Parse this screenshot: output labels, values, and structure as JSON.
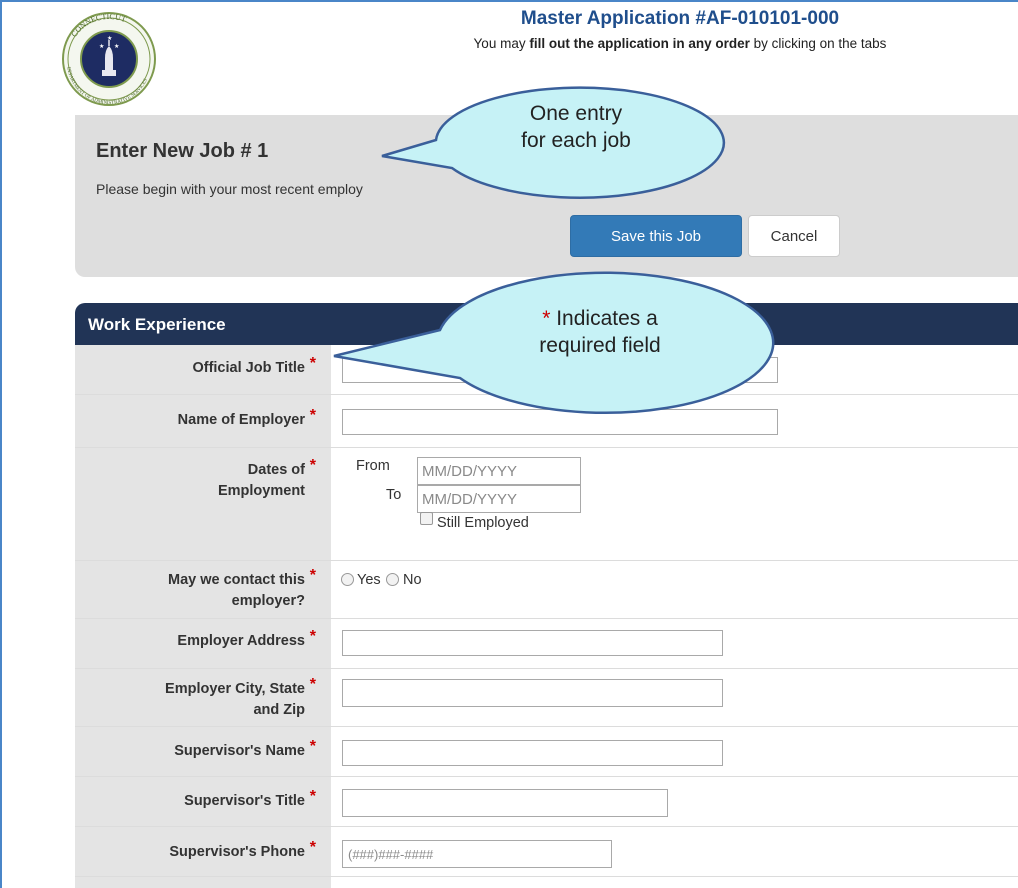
{
  "header": {
    "title": "Master Application #AF-010101-000",
    "sub_pre": "You may ",
    "sub_bold1": "fill out the application in any order",
    "sub_post": " by clicking on the tabs",
    "logo_icon": "connecticut-das-seal-icon",
    "logo_text_top": "CONNECTICUT",
    "logo_text_bottom": "DEPARTMENT OF ADMINISTRATIVE SERVICES"
  },
  "job": {
    "title": "Enter New Job # 1",
    "subtitle": "Please begin with your most recent employ",
    "save_label": "Save this Job",
    "cancel_label": "Cancel"
  },
  "callouts": {
    "one_line1": "One entry",
    "one_line2": "for each job",
    "req_star": "*",
    "req_line1": " Indicates a",
    "req_line2": "required field"
  },
  "work": {
    "header": "Work Experience",
    "required_mark": "*",
    "job_title_label": "Official Job Title",
    "employer_label": "Name of Employer",
    "dates_label_1": "Dates of",
    "dates_label_2": "Employment",
    "from_label": "From",
    "to_label": "To",
    "date_placeholder": "MM/DD/YYYY",
    "still_employed": "Still Employed",
    "contact_label_1": "May we contact this",
    "contact_label_2": "employer?",
    "yes": "Yes",
    "no": "No",
    "address_label": "Employer Address",
    "city_label_1": "Employer City, State",
    "city_label_2": "and Zip",
    "sup_name_label": "Supervisor's Name",
    "sup_title_label": "Supervisor's Title",
    "sup_phone_label": "Supervisor's Phone",
    "phone_placeholder": "(###)###-####"
  },
  "colors": {
    "accent": "#337ab7",
    "section_header": "#213456",
    "title_blue": "#1f4e8c",
    "required_red": "#cc0000",
    "callout_fill": "#c6f2f6",
    "callout_stroke": "#3a5f9a"
  }
}
